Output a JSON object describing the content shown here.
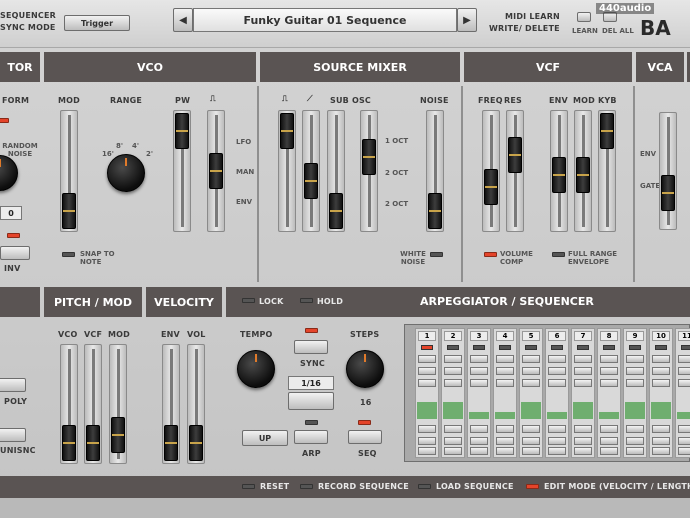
{
  "topbar": {
    "sequencer_label": "SEQUENCER",
    "sync_mode_label": "SYNC MODE",
    "trigger_button": "Trigger",
    "preset_name": "Funky Guitar 01 Sequence",
    "prev_arrow": "◀",
    "next_arrow": "▶",
    "midi_learn": "MIDI LEARN",
    "write_delete": "WRITE/ DELETE",
    "learn": "LEARN",
    "del_all": "DEL ALL",
    "brand": "440audio",
    "logo_part": "BA"
  },
  "lfo": {
    "title": "TOR",
    "waveform": "FORM",
    "random_noise": "RANDOM NOISE",
    "value": "0",
    "inv": "INV"
  },
  "vco": {
    "title": "VCO",
    "mod": "MOD",
    "range": "RANGE",
    "pw": "PW",
    "pulse_symbol": "⎍",
    "range_ticks": [
      "16'",
      "8'",
      "4'",
      "2'"
    ],
    "pw_source": [
      "LFO",
      "MAN",
      "ENV"
    ],
    "snap": "SNAP TO NOTE"
  },
  "source_mixer": {
    "title": "SOURCE MIXER",
    "sub_osc": "SUB OSC",
    "noise": "NOISE",
    "pulse_symbol": "⎍",
    "saw_symbol": "⟋",
    "oct_labels": [
      "1 OCT",
      "2 OCT",
      "2 OCT"
    ],
    "white_noise": "WHITE NOISE"
  },
  "vcf": {
    "title": "VCF",
    "freq": "FREQ",
    "res": "RES",
    "env": "ENV",
    "mod": "MOD",
    "kyb": "KYB",
    "volume_comp": "VOLUME COMP",
    "full_range": "FULL RANGE ENVELOPE"
  },
  "vca": {
    "title": "VCA",
    "env": "ENV",
    "gate": "GATE"
  },
  "pitch_mod": {
    "title": "PITCH / MOD",
    "vco": "VCO",
    "vcf": "VCF",
    "mod": "MOD"
  },
  "velocity": {
    "title": "VELOCITY",
    "env": "ENV",
    "vol": "VOL"
  },
  "left_lower": {
    "poly": "POLY",
    "unisnc": "UNISNC"
  },
  "arp": {
    "title": "ARPEGGIATOR / SEQUENCER",
    "lock": "LOCK",
    "hold": "HOLD",
    "tempo": "TEMPO",
    "sync": "SYNC",
    "steps": "STEPS",
    "division": "1/16",
    "steps_value": "16",
    "up": "UP",
    "arp": "ARP",
    "seq": "SEQ",
    "step_numbers": [
      "1",
      "2",
      "3",
      "4",
      "5",
      "6",
      "7",
      "8",
      "9",
      "10",
      "11"
    ],
    "step_levels": [
      0.28,
      0.28,
      0.12,
      0.12,
      0.28,
      0.12,
      0.28,
      0.12,
      0.28,
      0.28,
      0.12
    ]
  },
  "footer": {
    "reset": "RESET",
    "record": "RECORD SEQUENCE",
    "load": "LOAD SEQUENCE",
    "edit_mode": "EDIT MODE (VELOCITY / LENGTH"
  }
}
